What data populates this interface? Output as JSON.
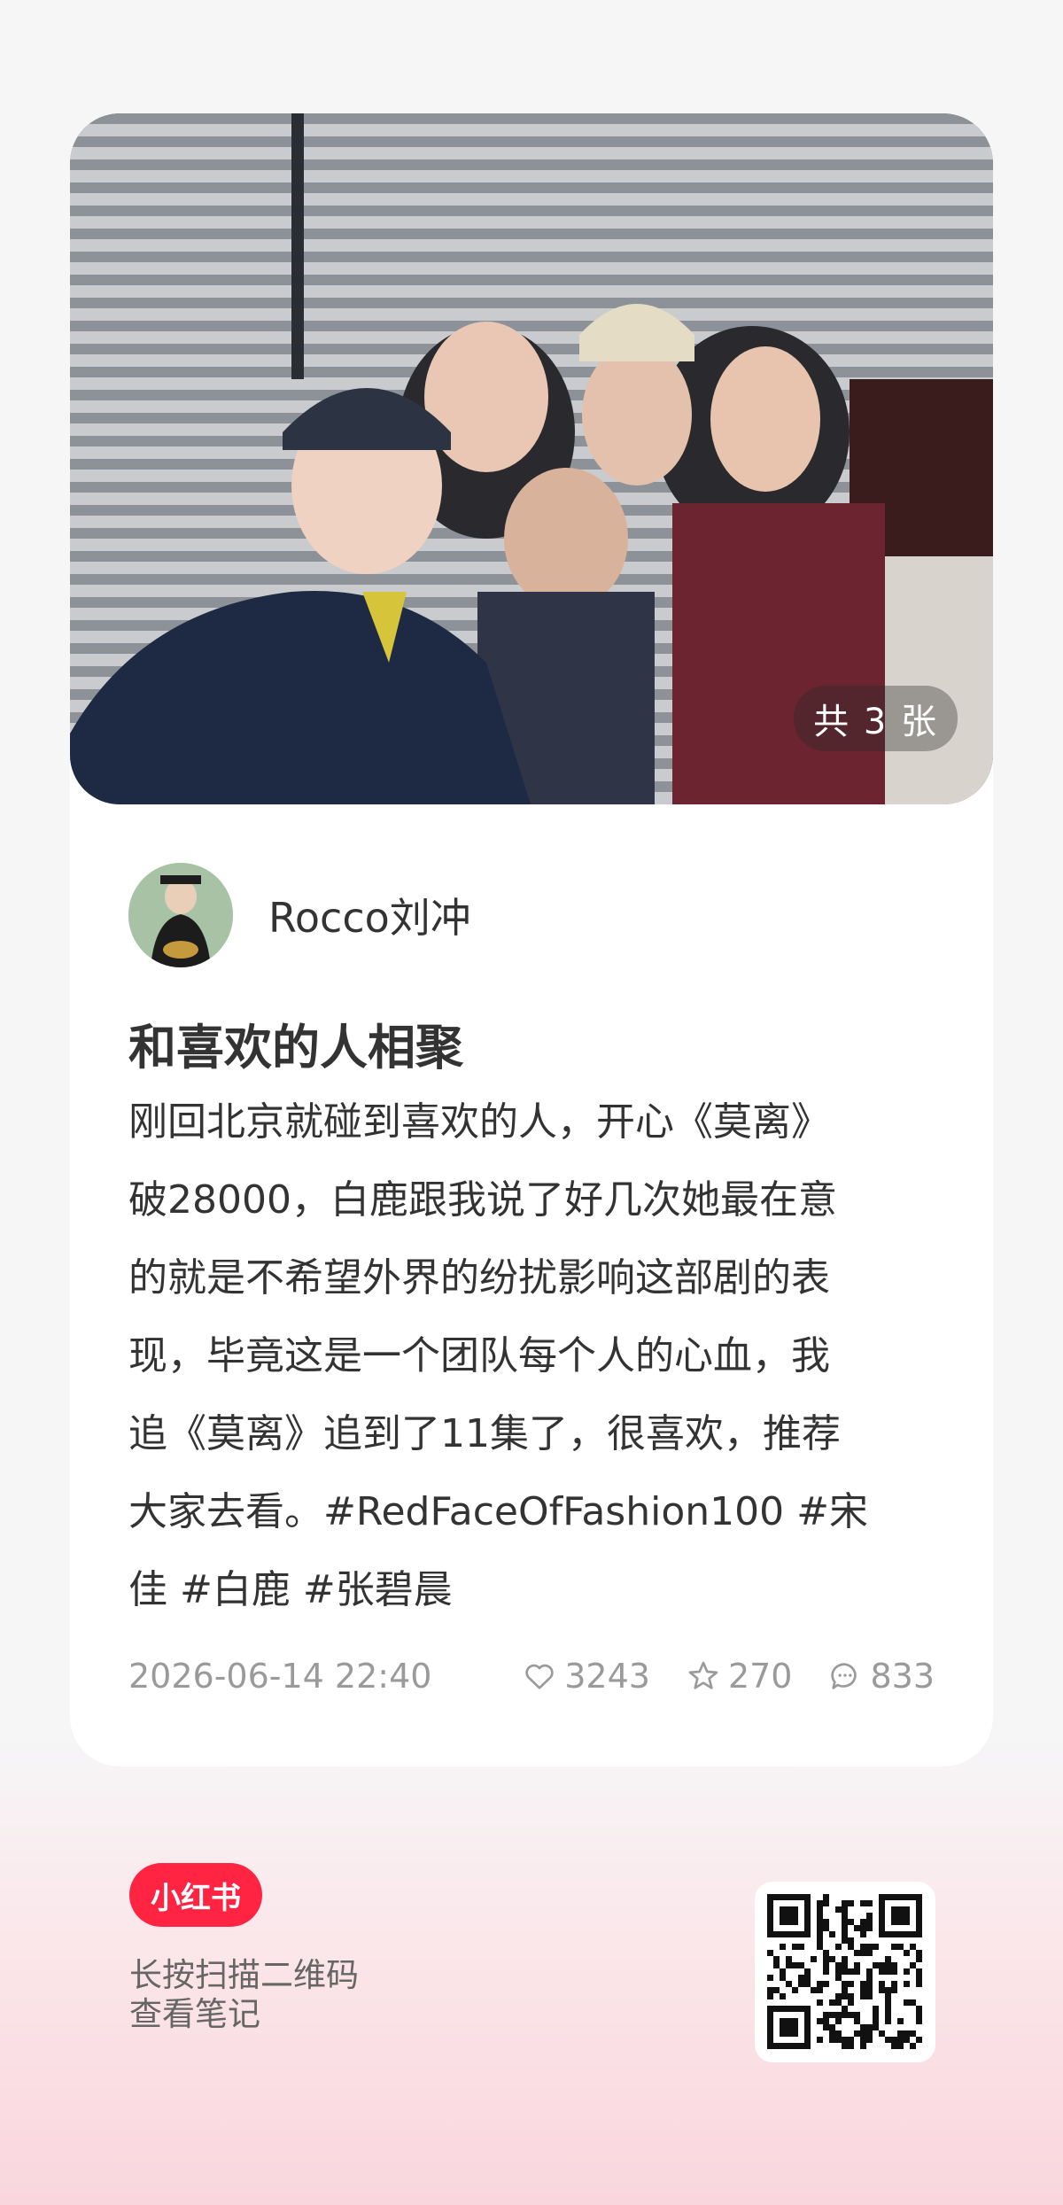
{
  "post": {
    "photo_count_label": "共 3 张",
    "author_name": "Rocco刘冲",
    "title": "和喜欢的人相聚",
    "body_lines": [
      "刚回北京就碰到喜欢的人，开心《莫离》",
      "破28000，白鹿跟我说了好几次她最在意",
      "的就是不希望外界的纷扰影响这部剧的表",
      "现，毕竟这是一个团队每个人的心血，我",
      "追《莫离》追到了11集了，很喜欢，推荐",
      "大家去看。#RedFaceOfFashion100 #宋",
      "佳 #白鹿 #张碧晨"
    ],
    "date": "2026-06-14 22:40",
    "likes": "3243",
    "collects": "270",
    "comments": "833"
  },
  "footer": {
    "brand_label": "小红书",
    "scan_tip_line1": "长按扫描二维码",
    "scan_tip_line2": "查看笔记"
  },
  "icons": {
    "like": "heart-icon",
    "collect": "star-icon",
    "comment": "comment-icon"
  },
  "colors": {
    "brand": "#ff2442",
    "background": "#f6f6f7",
    "text_primary": "#333333",
    "text_secondary": "#9a9a9a"
  }
}
